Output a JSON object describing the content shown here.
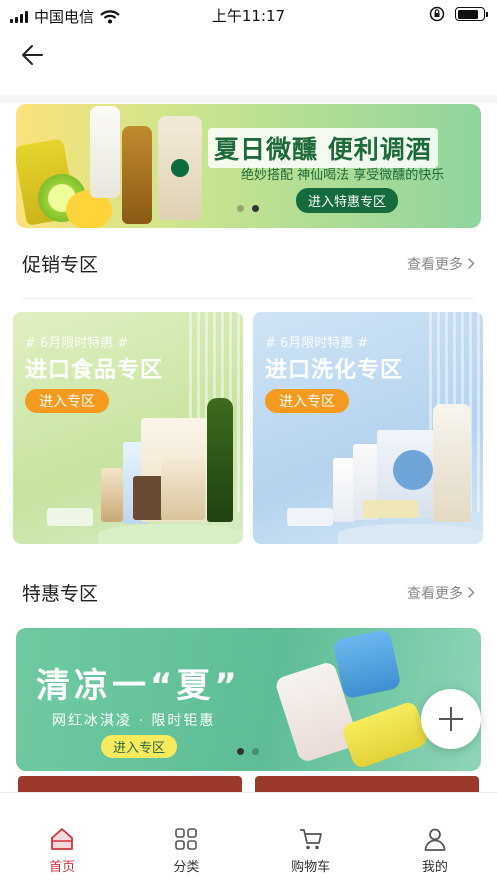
{
  "status_bar": {
    "carrier": "中国电信",
    "time": "上午11:17"
  },
  "banner_top": {
    "title": "夏日微醺 便利调酒",
    "subtitle": "绝妙搭配 神仙喝法 享受微醺的快乐",
    "button": "进入特惠专区",
    "dots_total": 2,
    "dots_active": 2
  },
  "promo_section": {
    "title": "促销专区",
    "more": "查看更多"
  },
  "cards": [
    {
      "tag": "# 6月限时特惠 #",
      "title": "进口食品专区",
      "button": "进入专区"
    },
    {
      "tag": "# 6月限时特惠 #",
      "title": "进口洗化专区",
      "button": "进入专区"
    }
  ],
  "deal_section": {
    "title": "特惠专区",
    "more": "查看更多"
  },
  "banner_bottom": {
    "title": "清凉一“夏”",
    "subtitle": "网红冰淇凌 · 限时钜惠",
    "button": "进入专区",
    "dots_total": 2,
    "dots_active": 1
  },
  "tabbar": {
    "items": [
      {
        "label": "首页",
        "icon": "home-icon",
        "active": true
      },
      {
        "label": "分类",
        "icon": "grid-icon",
        "active": false
      },
      {
        "label": "购物车",
        "icon": "cart-icon",
        "active": false
      },
      {
        "label": "我的",
        "icon": "user-icon",
        "active": false
      }
    ]
  },
  "colors": {
    "accent": "#d0323c",
    "orange_button": "#f39a1f",
    "green_banner": "#5ebd96"
  }
}
